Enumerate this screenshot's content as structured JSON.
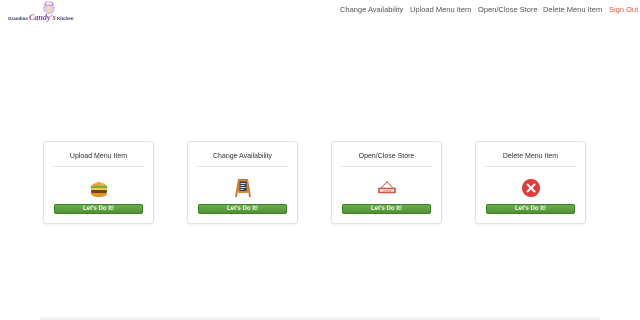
{
  "logo": {
    "text_small_left": "Grandma",
    "text_big": "Candy's",
    "text_small_right": "Kitchen"
  },
  "nav": {
    "change_availability": "Change Availability",
    "upload_menu_item": "Upload Menu Item",
    "open_close_store": "Open/Close Store",
    "delete_menu_item": "Delete Menu Item",
    "sign_out": "Sign Out"
  },
  "cards": [
    {
      "title": "Upload Menu Item",
      "button": "Let's Do It!",
      "icon": "burger-icon"
    },
    {
      "title": "Change Availability",
      "button": "Let's Do It!",
      "icon": "sandwich-board-icon"
    },
    {
      "title": "Open/Close Store",
      "button": "Let's Do It!",
      "icon": "closed-sign-icon"
    },
    {
      "title": "Delete Menu Item",
      "button": "Let's Do It!",
      "icon": "delete-x-icon"
    }
  ],
  "colors": {
    "button_green": "#5a9e3e",
    "sign_out_red": "#e05a4a",
    "delete_red": "#e03b3b"
  }
}
